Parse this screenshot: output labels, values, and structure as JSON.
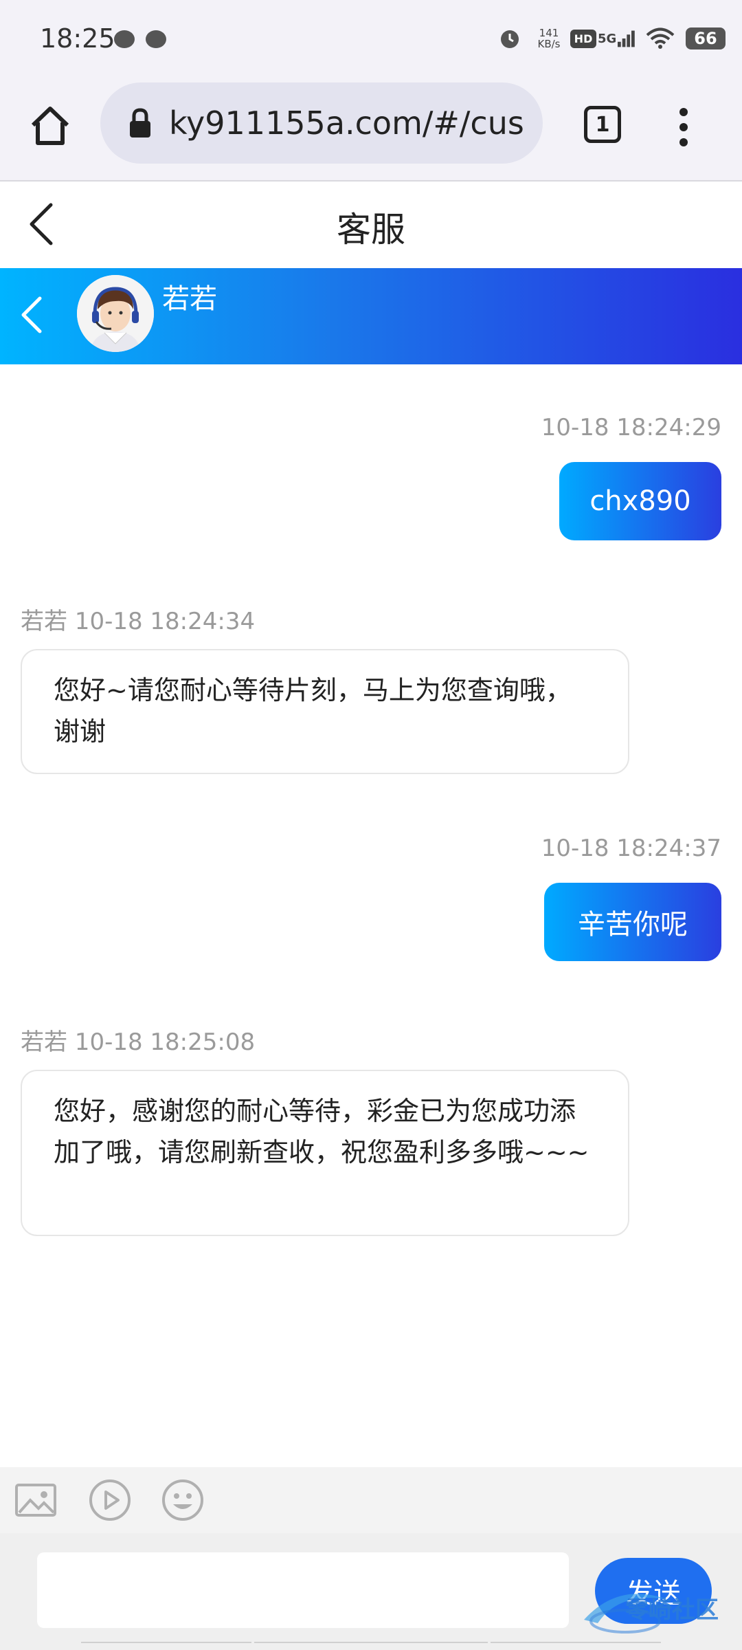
{
  "status_bar": {
    "time": "18:25",
    "net_speed_value": "141",
    "net_speed_unit": "KB/s",
    "hd_label": "HD",
    "network": "5G",
    "battery": "66"
  },
  "browser": {
    "url": "ky911155a.com/#/cus ",
    "tab_count": "1"
  },
  "page": {
    "title": "客服"
  },
  "agent": {
    "name": "若若"
  },
  "messages": [
    {
      "direction": "out",
      "timestamp": "10-18 18:24:29",
      "text": "chx890"
    },
    {
      "direction": "in",
      "header": "若若 10-18 18:24:34",
      "text": "您好~请您耐心等待片刻，马上为您查询哦，谢谢"
    },
    {
      "direction": "out",
      "timestamp": "10-18 18:24:37",
      "text": "辛苦你呢"
    },
    {
      "direction": "in",
      "header": "若若 10-18 18:25:08",
      "text": "您好，感谢您的耐心等待，彩金已为您成功添加了哦，请您刷新查收，祝您盈利多多哦~~~"
    }
  ],
  "composer": {
    "input_value": "",
    "send_label": "发送"
  },
  "watermark": {
    "text": "零崎社区"
  },
  "colors": {
    "bubble_gradient_start": "#00aaff",
    "bubble_gradient_end": "#2a3fe0",
    "send_button": "#1f6ff0"
  }
}
